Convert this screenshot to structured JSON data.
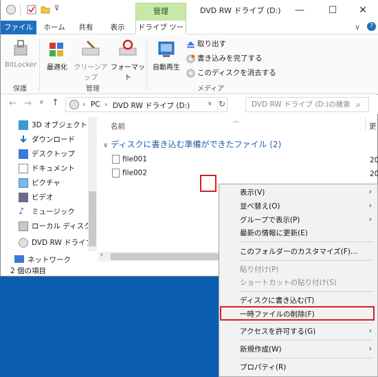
{
  "window": {
    "title": "DVD RW ドライブ (D:)",
    "context_tab_header": "管理",
    "controls": {
      "minimize": "—",
      "maximize": "☐",
      "close": "✕"
    }
  },
  "tabs": [
    "ファイル",
    "ホーム",
    "共有",
    "表示",
    "ドライブ ツール"
  ],
  "ribbon": {
    "groups": {
      "protect": "保護",
      "manage": "管理",
      "media": "メディア"
    },
    "buttons": {
      "bitlocker": "BitLocker",
      "optimize": "最適化",
      "cleanup": "クリーンアップ",
      "format": "フォーマット",
      "autoplay": "自動再生"
    },
    "media_cmds": [
      "取り出す",
      "書き込みを完了する",
      "このディスクを消去する"
    ]
  },
  "address": {
    "path": [
      "PC",
      "DVD RW ドライブ (D:)"
    ],
    "search_placeholder": "DVD RW ドライブ (D:)の検索"
  },
  "nav": {
    "items": [
      "3D オブジェクト",
      "ダウンロード",
      "デスクトップ",
      "ドキュメント",
      "ピクチャ",
      "ビデオ",
      "ミュージック",
      "ローカル ディスク (C",
      "DVD RW ドライブ (",
      "ネットワーク"
    ]
  },
  "content": {
    "column_name": "名前",
    "column_date_partial": "更",
    "group_title": "ディスクに書き込む準備ができたファイル (2)",
    "files": [
      {
        "name": "file001",
        "date_partial": "20"
      },
      {
        "name": "file002",
        "date_partial": "20"
      }
    ]
  },
  "status": {
    "count": "2 個の項目"
  },
  "context_menu": {
    "items": [
      {
        "label": "表示(V)",
        "submenu": true,
        "disabled": false
      },
      {
        "label": "並べ替え(O)",
        "submenu": true,
        "disabled": false
      },
      {
        "label": "グループで表示(P)",
        "submenu": true,
        "disabled": false
      },
      {
        "label": "最新の情報に更新(E)",
        "submenu": false,
        "disabled": false
      },
      {
        "label": "このフォルダーのカスタマイズ(F)...",
        "submenu": false,
        "disabled": false
      },
      {
        "label": "貼り付け(P)",
        "submenu": false,
        "disabled": true
      },
      {
        "label": "ショートカットの貼り付け(S)",
        "submenu": false,
        "disabled": true
      },
      {
        "label": "ディスクに書き込む(T)",
        "submenu": false,
        "disabled": false
      },
      {
        "label": "一時ファイルの削除(F)",
        "submenu": false,
        "disabled": false
      },
      {
        "label": "アクセスを許可する(G)",
        "submenu": true,
        "disabled": false
      },
      {
        "label": "新規作成(W)",
        "submenu": true,
        "disabled": false
      },
      {
        "label": "プロパティ(R)",
        "submenu": false,
        "disabled": false
      }
    ]
  },
  "colors": {
    "accent": "#1e6fc0",
    "context_tab": "#c8e8a8",
    "highlight": "#d42020",
    "desktop": "#0b5eb0"
  }
}
